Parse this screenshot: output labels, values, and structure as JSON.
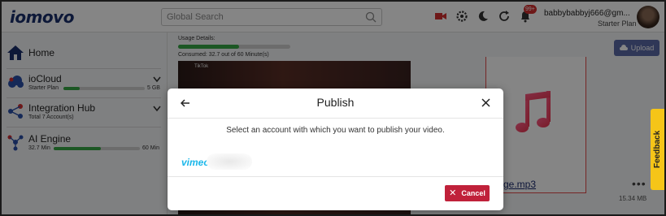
{
  "header": {
    "logo_text": "iomovo",
    "search_placeholder": "Global Search",
    "notification_count": "99+",
    "user_email": "babbybabbyj666@gm...",
    "user_plan": "Starter Plan"
  },
  "sidebar": {
    "home_label": "Home",
    "items": [
      {
        "title": "ioCloud",
        "sub": "Starter Plan",
        "bar_value": "5 GB",
        "bar_fraction": 0.2
      },
      {
        "title": "Integration Hub",
        "sub": "Total 7 Account(s)"
      },
      {
        "title": "AI Engine",
        "sub": "32.7 Min",
        "bar_value": "60 Min",
        "bar_fraction": 0.545
      }
    ]
  },
  "main": {
    "usage_label": "Usage Details:",
    "usage_consumed": "Consumed: 32.7 out of 60 Minute(s)",
    "usage_fraction": 0.545,
    "upload_label": "Upload",
    "video_overlay_text": "TikTok",
    "audio_name": "ge.mp3",
    "audio_dots": "•••",
    "audio_size": "15.34 MB"
  },
  "feedback": {
    "label": "Feedback",
    "brand": "iomovo"
  },
  "modal": {
    "title": "Publish",
    "prompt": "Select an account with which you want to publish your video.",
    "accounts": [
      {
        "service": "vimeo",
        "logo_text": "vimeo"
      }
    ],
    "cancel_label": "Cancel"
  },
  "colors": {
    "brand_navy": "#1a2f6b",
    "progress_green": "#36a845",
    "cancel_red": "#c0213a",
    "upload_blue": "#5a6aa8",
    "vimeo_blue": "#1ab7ea",
    "feedback_yellow": "#f5c518"
  }
}
